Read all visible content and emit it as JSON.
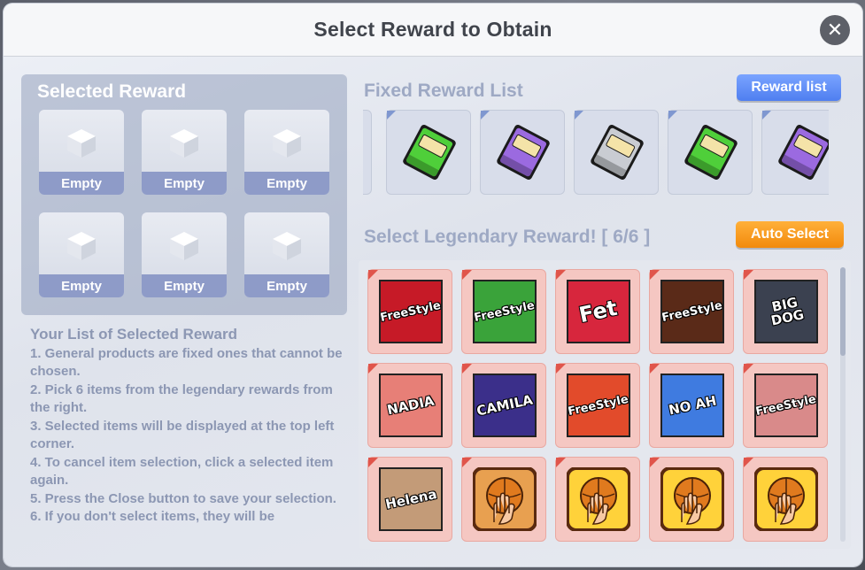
{
  "dialog": {
    "title": "Select Reward to Obtain"
  },
  "selected_panel": {
    "heading": "Selected Reward",
    "slots": [
      {
        "label": "Empty"
      },
      {
        "label": "Empty"
      },
      {
        "label": "Empty"
      },
      {
        "label": "Empty"
      },
      {
        "label": "Empty"
      },
      {
        "label": "Empty"
      }
    ]
  },
  "info": {
    "title": "Your List of Selected Reward",
    "lines": [
      "1. General products are fixed ones that cannot be chosen.",
      "2. Pick 6 items from the legendary rewards from the right.",
      "3. Selected items will be displayed at the top left corner.",
      "4. To cancel item selection, click a selected item again.",
      "5. Press the Close button to save your selection.",
      "6. If you don't select items, they will be"
    ]
  },
  "fixed": {
    "title": "Fixed Reward List",
    "button": "Reward list",
    "items": [
      {
        "icon": "green-cartridge-icon",
        "color": "#4fcf3a"
      },
      {
        "icon": "purple-cartridge-icon",
        "color": "#9b6ae0"
      },
      {
        "icon": "silver-cartridge-icon",
        "color": "#c9ccd2"
      },
      {
        "icon": "green-cartridge-icon",
        "color": "#4fcf3a"
      },
      {
        "icon": "purple-cartridge-icon",
        "color": "#9b6ae0"
      }
    ]
  },
  "legendary": {
    "title": "Select Legendary Reward! [ 6/6 ]",
    "button": "Auto Select",
    "items": [
      {
        "text": "FreeStyle",
        "bg": "#c61a27",
        "icon": "freestyle-logo-icon"
      },
      {
        "text": "FreeStyle",
        "bg": "#3aa33a",
        "icon": "freestyle-graffiti-icon"
      },
      {
        "text": "Fet",
        "bg": "#d7263d",
        "icon": "fet-logo-icon"
      },
      {
        "text": "FreeStyle",
        "bg": "#5a2a18",
        "icon": "freestyle-fire-icon"
      },
      {
        "text": "BIG DOG",
        "bg": "#3b4150",
        "icon": "bigdog-logo-icon"
      },
      {
        "text": "NADIA",
        "bg": "#e77f77",
        "icon": "nadia-logo-icon"
      },
      {
        "text": "CAMILA",
        "bg": "#3b2f8a",
        "icon": "camila-logo-icon"
      },
      {
        "text": "FreeStyle",
        "bg": "#e24b2b",
        "icon": "freestyle-brick-icon"
      },
      {
        "text": "NO AH",
        "bg": "#3f7be0",
        "icon": "noah-logo-icon"
      },
      {
        "text": "FreeStyle",
        "bg": "#d98a8a",
        "icon": "freestyle-pinkbrick-icon"
      },
      {
        "text": "Helena",
        "bg": "#c39b78",
        "icon": "helena-logo-icon"
      },
      {
        "text": "",
        "bg": "#e8a050",
        "icon": "hand-ball-icon"
      },
      {
        "text": "",
        "bg": "#ffd23a",
        "icon": "hand-ball-icon"
      },
      {
        "text": "",
        "bg": "#ffd23a",
        "icon": "hand-ball-icon"
      },
      {
        "text": "",
        "bg": "#ffd23a",
        "icon": "hand-ball-icon"
      }
    ]
  }
}
